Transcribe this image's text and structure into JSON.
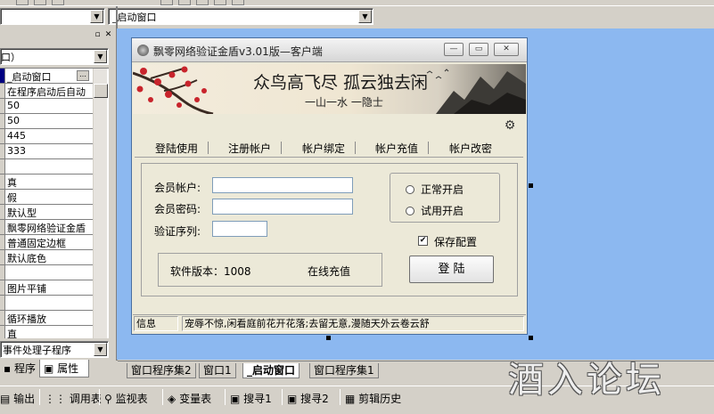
{
  "toolbar": {
    "left_combo_value": "",
    "right_combo_value": "_启动窗口"
  },
  "left_panel": {
    "object_combo_value": "口）",
    "properties": [
      {
        "value": "_启动窗口",
        "selected": true
      },
      {
        "value": "在程序启动后自动"
      },
      {
        "value": "50"
      },
      {
        "value": "50"
      },
      {
        "value": "445"
      },
      {
        "value": "333"
      },
      {
        "value": ""
      },
      {
        "value": "真"
      },
      {
        "value": "假"
      },
      {
        "value": "默认型"
      },
      {
        "value": "飘零网络验证金盾"
      },
      {
        "value": "普通固定边框"
      },
      {
        "value": "默认底色"
      },
      {
        "value": ""
      },
      {
        "value": "图片平铺"
      },
      {
        "value": ""
      },
      {
        "value": "循环播放"
      },
      {
        "value": "直"
      }
    ],
    "event_combo_value": "事件处理子程序",
    "tabs": [
      "程序",
      "属性"
    ]
  },
  "designed_window": {
    "title": "飘零网络验证金盾v3.01版—客户端",
    "banner_text": "众鸟高飞尽  孤云独去闲",
    "banner_subtext": "一山一水 一隐士",
    "tabs": [
      "登陆使用",
      "注册帐户",
      "帐户绑定",
      "帐户充值",
      "帐户改密"
    ],
    "account_label": "会员帐户:",
    "password_label": "会员密码:",
    "captcha_label": "验证序列:",
    "radio_normal": "正常开启",
    "radio_trial": "试用开启",
    "save_config": "保存配置",
    "version_text": "软件版本：1008",
    "online_recharge": "在线充值",
    "login_button": "登  陆",
    "status_label": "信息",
    "status_message": "宠辱不惊,闲看庭前花开花落;去留无意,漫随天外云卷云舒"
  },
  "doc_tabs": [
    "窗口程序集2",
    "窗口1",
    "_启动窗口",
    "窗口程序集1"
  ],
  "bottom_bar": [
    "输出",
    "调用表",
    "监视表",
    "变量表",
    "搜寻1",
    "搜寻2",
    "剪辑历史"
  ],
  "watermark": "酒入论坛",
  "colors": {
    "design_bg": "#8cb8f0",
    "selection": "#000080"
  }
}
